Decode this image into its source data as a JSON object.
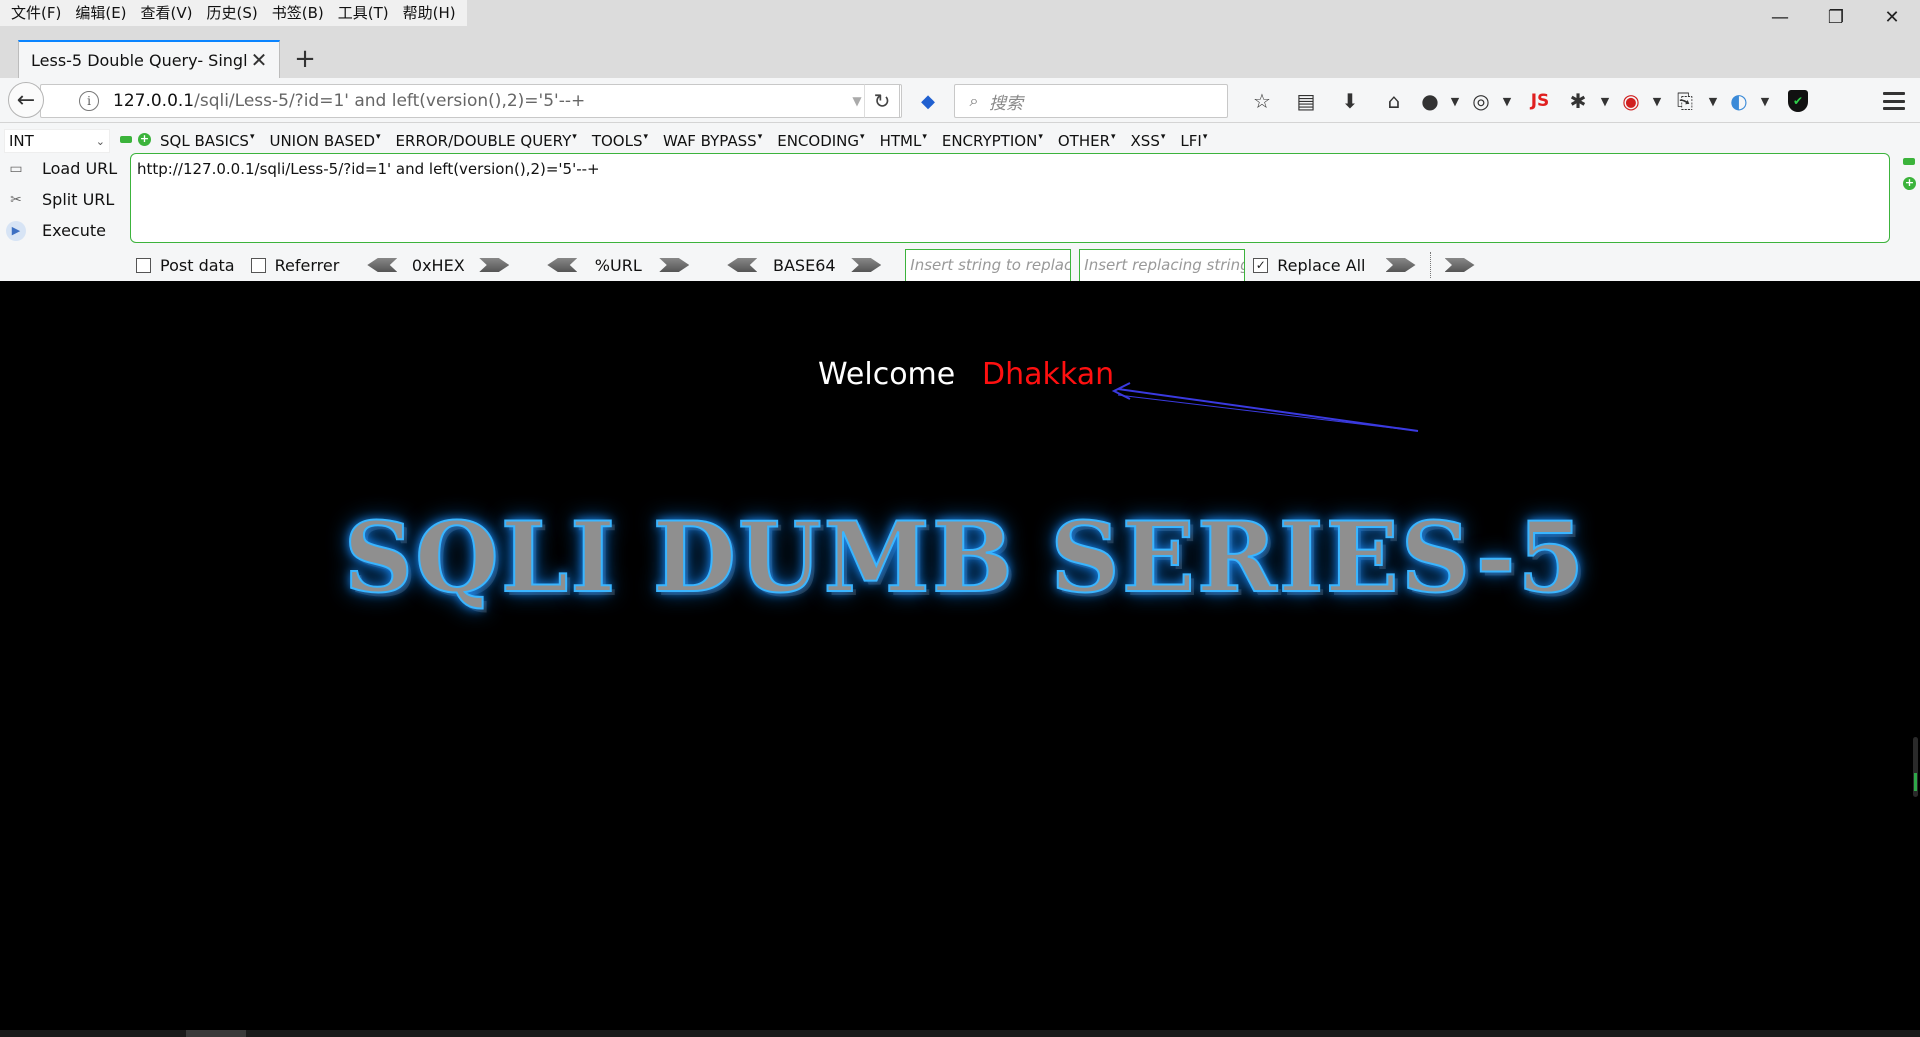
{
  "menubar": {
    "items": [
      "文件(F)",
      "编辑(E)",
      "查看(V)",
      "历史(S)",
      "书签(B)",
      "工具(T)",
      "帮助(H)"
    ]
  },
  "window": {
    "minimize": "—",
    "restore": "❐",
    "close": "✕"
  },
  "tab": {
    "title": "Less-5 Double Query- Singl...",
    "close": "✕",
    "new_tab": "+"
  },
  "navbar": {
    "back": "←",
    "url_host": "127.0.0.1",
    "url_path": "/sqli/Less-5/?id=1' and left(version(),2)='5'--+",
    "reload": "↻",
    "search_placeholder": "搜索",
    "js_label": "JS"
  },
  "hackbar": {
    "select_value": "INT",
    "menus": [
      "SQL BASICS",
      "UNION BASED",
      "ERROR/DOUBLE QUERY",
      "TOOLS",
      "WAF BYPASS",
      "ENCODING",
      "HTML",
      "ENCRYPTION",
      "OTHER",
      "XSS",
      "LFI"
    ],
    "load_url": "Load URL",
    "split_url": "Split URL",
    "execute": "Execute",
    "url_value": "http://127.0.0.1/sqli/Less-5/?id=1' and left(version(),2)='5'--+",
    "post_data": "Post data",
    "referrer": "Referrer",
    "hex": "0xHEX",
    "url_enc": "%URL",
    "base64": "BASE64",
    "replace_placeholder": "Insert string to replace",
    "replacing_placeholder": "Insert replacing string",
    "replace_all": "Replace All",
    "replace_all_checked": true
  },
  "page": {
    "welcome": "Welcome",
    "username": "Dhakkan",
    "banner": "SQLI DUMB SERIES-5"
  },
  "colors": {
    "accent_tab": "#0a84ff",
    "hackbar_green": "#3cb33c",
    "username_red": "#ff1010",
    "banner_glow": "#1e90ff",
    "arrow_blue": "#3a3ae0"
  }
}
